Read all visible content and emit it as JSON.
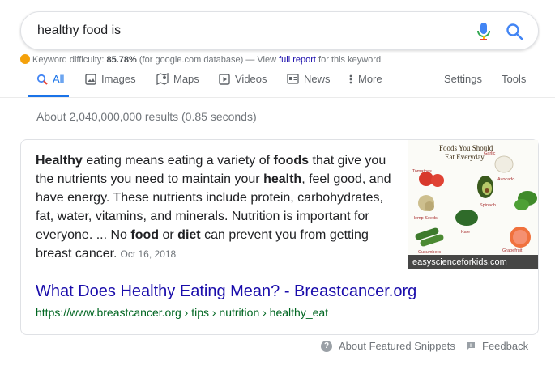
{
  "search": {
    "query": "healthy food is"
  },
  "keyword_difficulty": {
    "label": "Keyword difficulty:",
    "value": "85.78%",
    "source": "(for google.com database) — View",
    "link": "full report",
    "suffix": "for this keyword"
  },
  "tabs": [
    {
      "label": "All",
      "icon": "search-icon",
      "active": true
    },
    {
      "label": "Images",
      "icon": "image-icon"
    },
    {
      "label": "Maps",
      "icon": "map-icon"
    },
    {
      "label": "Videos",
      "icon": "play-icon"
    },
    {
      "label": "News",
      "icon": "news-icon"
    },
    {
      "label": "More",
      "icon": "more-vertical-icon"
    }
  ],
  "tools": {
    "settings": "Settings",
    "tools": "Tools"
  },
  "stats": "About 2,040,000,000 results (0.85 seconds)",
  "snippet": {
    "segments": [
      {
        "text": "Healthy",
        "bold": true
      },
      {
        "text": " eating means eating a variety of "
      },
      {
        "text": "foods",
        "bold": true
      },
      {
        "text": " that give you the nutrients you need to maintain your "
      },
      {
        "text": "health",
        "bold": true
      },
      {
        "text": ", feel good, and have energy. These nutrients include protein, carbohydrates, fat, water, vitamins, and minerals. Nutrition is important for everyone. ... No "
      },
      {
        "text": "food",
        "bold": true
      },
      {
        "text": " or "
      },
      {
        "text": "diet",
        "bold": true
      },
      {
        "text": " can prevent you from getting breast cancer."
      }
    ],
    "date": "Oct 16, 2018",
    "image": {
      "heading_line1": "Foods You Should",
      "heading_line2": "Eat Everyday",
      "labels": [
        "Garlic",
        "Tomatoes",
        "Avocado",
        "Spinach",
        "Hemp Seeds",
        "Kale",
        "Cucumbers",
        "Grapefruit"
      ],
      "caption": "easyscienceforkids.com"
    },
    "result_title": "What Does Healthy Eating Mean? - Breastcancer.org",
    "result_url": "https://www.breastcancer.org › tips › nutrition › healthy_eat"
  },
  "footer": {
    "about": "About Featured Snippets",
    "feedback": "Feedback"
  },
  "colors": {
    "link": "#1a0dab",
    "url_green": "#006621",
    "accent": "#1a73e8"
  }
}
